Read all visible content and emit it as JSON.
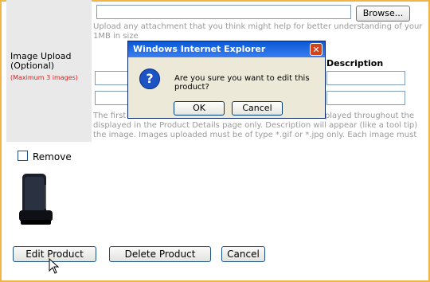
{
  "form": {
    "browse_label": "Browse...",
    "upload_hint": "Upload any attachment that you think might help for better understanding of your",
    "upload_hint2": "1MB in size",
    "image_upload_label": "Image Upload (Optional)",
    "image_upload_sub": "(Maximum 3 images)",
    "description_header": "Description",
    "hint_line1": "The first                                                                          displayed throughout the",
    "hint_line2": "displayed in the Product Details page only. Description will appear (like a tool tip)",
    "hint_line3": "the image. Images uploaded must be of type *.gif or *.jpg only. Each image must",
    "remove_label": "Remove"
  },
  "buttons": {
    "edit": "Edit Product",
    "delete": "Delete Product",
    "cancel": "Cancel"
  },
  "dialog": {
    "title": "Windows Internet Explorer",
    "message": "Are you sure you want to edit this product?",
    "ok": "OK",
    "cancel": "Cancel",
    "icon": "question-icon",
    "close_icon": "close-icon"
  },
  "colors": {
    "frame": "#f0b547",
    "required": "#e31c1c",
    "titlebar": "#0a58d6"
  }
}
